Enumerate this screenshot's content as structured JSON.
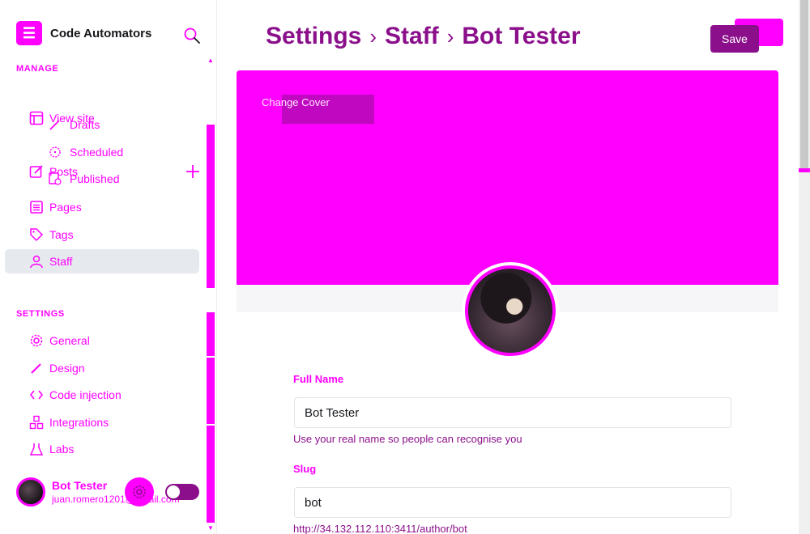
{
  "sidebar": {
    "brand": {
      "title": "Code Automators"
    },
    "manage_label": "MANAGE",
    "settings_label": "SETTINGS",
    "items": [
      {
        "label": "View site",
        "icon": "layout-icon"
      },
      {
        "label": "Posts",
        "icon": "pencil-square-icon"
      },
      {
        "label": "Pages",
        "icon": "pages-icon"
      },
      {
        "label": "Tags",
        "icon": "tag-icon"
      },
      {
        "label": "Staff",
        "icon": "staff-icon"
      }
    ],
    "post_subitems": [
      {
        "label": "Drafts",
        "icon": "pencil-icon"
      },
      {
        "label": "Scheduled",
        "icon": "clock-icon"
      },
      {
        "label": "Published",
        "icon": "published-icon"
      }
    ],
    "settings_items": [
      {
        "label": "General",
        "icon": "gear-icon"
      },
      {
        "label": "Design",
        "icon": "brush-icon"
      },
      {
        "label": "Code injection",
        "icon": "code-icon"
      },
      {
        "label": "Integrations",
        "icon": "integrations-icon"
      },
      {
        "label": "Labs",
        "icon": "labs-icon"
      }
    ],
    "footer": {
      "name": "Bot Tester",
      "email": "juan.romero1201@gmail.com",
      "night_mode": false
    }
  },
  "header": {
    "breadcrumb": [
      "Settings",
      "Staff",
      "Bot Tester"
    ],
    "save_label": "Save"
  },
  "cover": {
    "change_label": "Change Cover"
  },
  "form": {
    "full_name": {
      "label": "Full Name",
      "value": "Bot Tester",
      "hint": "Use your real name so people can recognise you"
    },
    "slug": {
      "label": "Slug",
      "value": "bot",
      "hint": "http://34.132.112.110:3411/author/bot"
    }
  },
  "colors": {
    "accent": "#ff00ff",
    "accent_dark": "#8b0f8b"
  }
}
